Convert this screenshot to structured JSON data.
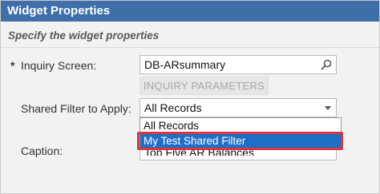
{
  "dialog": {
    "title": "Widget Properties",
    "subtitle": "Specify the widget properties"
  },
  "form": {
    "required_marker": "*",
    "inquiry_screen": {
      "label": "Inquiry Screen:",
      "value": "DB-ARsummary",
      "icon": "search-icon"
    },
    "inquiry_parameters_button": "INQUIRY PARAMETERS",
    "shared_filter": {
      "label": "Shared Filter to Apply:",
      "value": "All Records",
      "options": [
        "All Records",
        "My Test Shared Filter"
      ],
      "selected_index": 1
    },
    "caption": {
      "label": "Caption:",
      "value": "Top Five AR Balances"
    }
  },
  "colors": {
    "titlebar": "#3e6fa8",
    "selected_option": "#1e6fc7",
    "highlight_box": "#d9363e"
  }
}
